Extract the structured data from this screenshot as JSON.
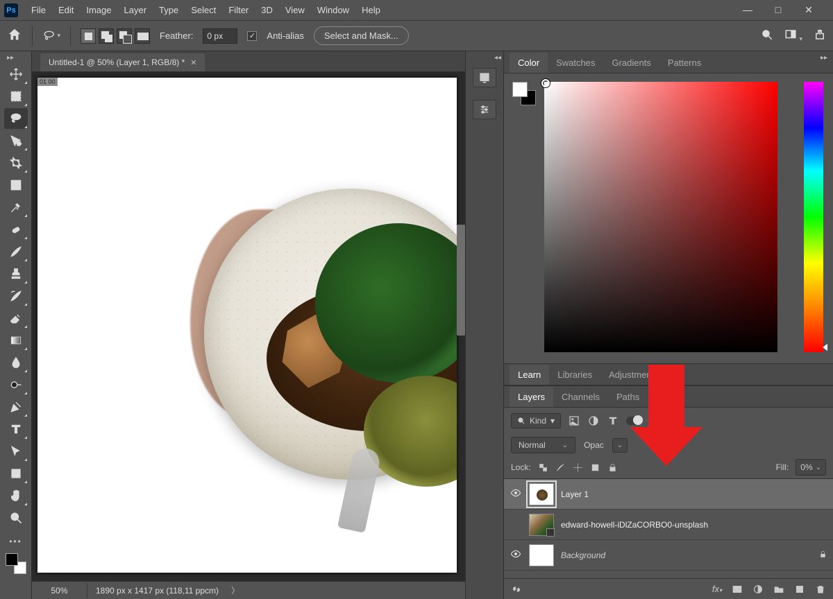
{
  "menubar": {
    "logo": "Ps",
    "items": [
      "File",
      "Edit",
      "Image",
      "Layer",
      "Type",
      "Select",
      "Filter",
      "3D",
      "View",
      "Window",
      "Help"
    ]
  },
  "window_controls": {
    "min": "—",
    "max": "□",
    "close": "✕"
  },
  "optionsbar": {
    "feather_label": "Feather:",
    "feather_value": "0 px",
    "antialias_label": "Anti-alias",
    "antialias_checked": "✓",
    "select_mask_btn": "Select and Mask..."
  },
  "document": {
    "tab_title": "Untitled-1 @ 50% (Layer 1, RGB/8) *",
    "ruler_tag": "01 00"
  },
  "statusbar": {
    "zoom": "50%",
    "docinfo": "1890 px x 1417 px (118,11 ppcm)"
  },
  "panels": {
    "color_tabs": [
      "Color",
      "Swatches",
      "Gradients",
      "Patterns"
    ],
    "learn_tabs": [
      "Learn",
      "Libraries",
      "Adjustments"
    ],
    "layer_tabs": [
      "Layers",
      "Channels",
      "Paths"
    ]
  },
  "layers_panel": {
    "kind_label": "Kind",
    "search_icon": "⌕",
    "blend_mode": "Normal",
    "opacity_label": "Opac",
    "lock_label": "Lock:",
    "fill_label": "Fill:",
    "fill_value": "0%",
    "layers": [
      {
        "name": "Layer 1",
        "visible": true,
        "selected": true
      },
      {
        "name": "edward-howell-iDlZaCORBO0-unsplash",
        "visible": false,
        "selected": false,
        "smart": true
      },
      {
        "name": "Background",
        "visible": true,
        "selected": false,
        "locked": true,
        "italic": true
      }
    ]
  },
  "tooltips": {
    "home": "home-icon",
    "lasso": "lasso-tool-icon"
  }
}
